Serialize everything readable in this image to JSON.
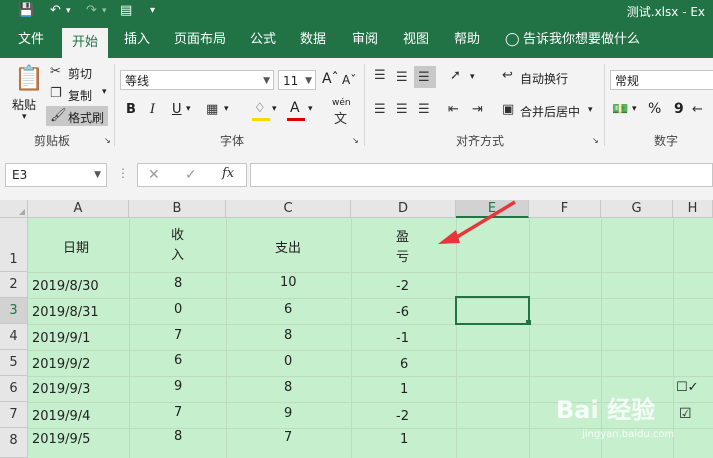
{
  "title_bar": {
    "filename": "测试.xlsx  -  Ex"
  },
  "menu": [
    "文件",
    "开始",
    "插入",
    "页面布局",
    "公式",
    "数据",
    "审阅",
    "视图",
    "帮助"
  ],
  "tell_me": "告诉我你想要做什么",
  "ribbon": {
    "paste": "粘贴",
    "cut": "剪切",
    "copy": "复制",
    "format_painter": "格式刷",
    "clipboard_group": "剪贴板",
    "font_name": "等线",
    "font_size": "11",
    "bold": "B",
    "italic": "I",
    "underline": "U",
    "font_color_letter": "A",
    "wen": "wén",
    "font_group": "字体",
    "wrap_text": "自动换行",
    "merge_center": "合并后居中",
    "alignment_group": "对齐方式",
    "number_format": "常规",
    "percent": "%",
    "comma": "9",
    "number_group": "数字"
  },
  "formula_bar": {
    "name_box": "E3",
    "fx": "fx",
    "formula": ""
  },
  "columns": [
    "A",
    "B",
    "C",
    "D",
    "E",
    "F",
    "G",
    "H"
  ],
  "row_numbers": [
    "1",
    "2",
    "3",
    "4",
    "5",
    "6",
    "7",
    "8"
  ],
  "headers": {
    "date": "日期",
    "income_1": "收",
    "income_2": "入",
    "expense": "支出",
    "pl_1": "盈",
    "pl_2": "亏"
  },
  "rows": [
    {
      "date": "2019/8/30",
      "income": "8",
      "expense": "10",
      "pl": "-2"
    },
    {
      "date": "2019/8/31",
      "income": "0",
      "expense": "6",
      "pl": "-6"
    },
    {
      "date": "2019/9/1",
      "income": "7",
      "expense": "8",
      "pl": "-1"
    },
    {
      "date": "2019/9/2",
      "income": "6",
      "expense": "0",
      "pl": "6"
    },
    {
      "date": "2019/9/3",
      "income": "9",
      "expense": "8",
      "pl": "1"
    },
    {
      "date": "2019/9/4",
      "income": "7",
      "expense": "9",
      "pl": "-2"
    },
    {
      "date": "2019/9/5",
      "income": "8",
      "expense": "7",
      "pl": "1"
    }
  ],
  "checkboxes": {
    "h6": "☐✓",
    "h7": "☑"
  },
  "watermark": {
    "brand": "Bai 经验",
    "url": "jingyan.baidu.com"
  },
  "colors": {
    "excel_green": "#217346",
    "sheet_fill": "#c6efce",
    "arrow": "#e8353b"
  }
}
